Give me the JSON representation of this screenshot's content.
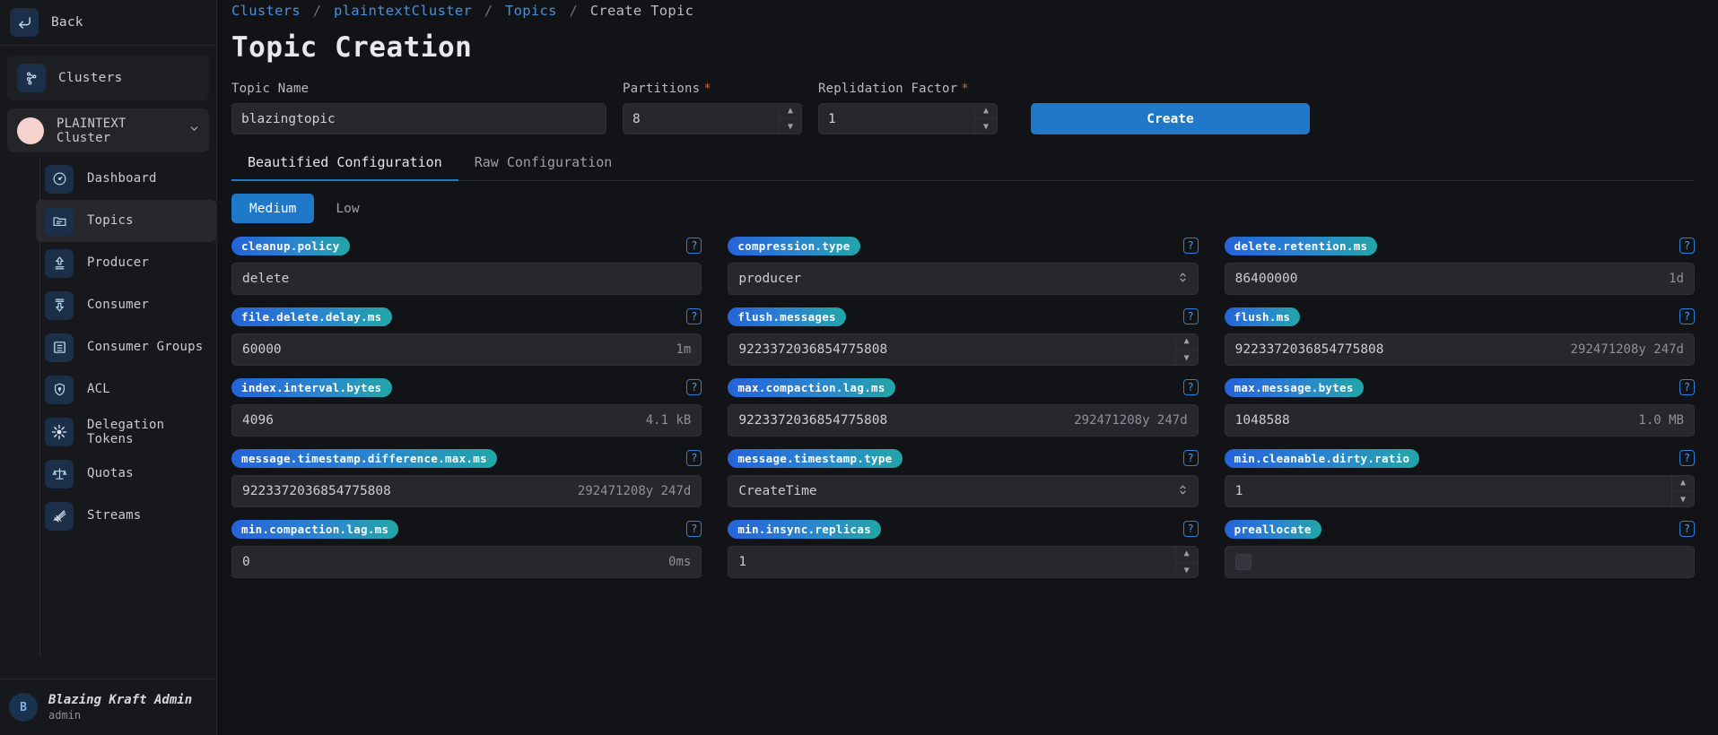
{
  "sidebar": {
    "back_label": "Back",
    "back_icon": "back-arrow-icon",
    "clusters_label": "Clusters",
    "clusters_icon": "cluster-nodes-icon",
    "selected_cluster": "PLAINTEXT Cluster",
    "chevron": "⌄",
    "nav": [
      {
        "label": "Dashboard",
        "icon": "gauge-icon",
        "active": false
      },
      {
        "label": "Topics",
        "icon": "folder-icon",
        "active": true
      },
      {
        "label": "Producer",
        "icon": "upload-arrow-icon",
        "active": false
      },
      {
        "label": "Consumer",
        "icon": "download-arrow-icon",
        "active": false
      },
      {
        "label": "Consumer Groups",
        "icon": "group-list-icon",
        "active": false
      },
      {
        "label": "ACL",
        "icon": "shield-lock-icon",
        "active": false
      },
      {
        "label": "Delegation Tokens",
        "icon": "token-burst-icon",
        "active": false
      },
      {
        "label": "Quotas",
        "icon": "scales-icon",
        "active": false
      },
      {
        "label": "Streams",
        "icon": "streams-icon",
        "active": false
      }
    ],
    "user": {
      "initial": "B",
      "name": "Blazing Kraft Admin",
      "role": "admin"
    }
  },
  "breadcrumb": {
    "items": [
      "Clusters",
      "plaintextCluster",
      "Topics"
    ],
    "current": "Create Topic",
    "separator": "/"
  },
  "page": {
    "title": "Topic Creation"
  },
  "form": {
    "topic_name": {
      "label": "Topic Name",
      "value": "blazingtopic",
      "required": false
    },
    "partitions": {
      "label": "Partitions",
      "value": "8",
      "required": true
    },
    "replication": {
      "label": "Replidation Factor",
      "value": "1",
      "required": true
    },
    "required_marker": "*",
    "create_button": "Create"
  },
  "tabs": [
    {
      "label": "Beautified Configuration",
      "active": true
    },
    {
      "label": "Raw Configuration",
      "active": false
    }
  ],
  "levels": [
    {
      "label": "Medium",
      "active": true
    },
    {
      "label": "Low",
      "active": false
    }
  ],
  "help_glyph": "?",
  "configs": [
    {
      "name": "cleanup.policy",
      "value": "delete",
      "suffix": "",
      "control": "text"
    },
    {
      "name": "compression.type",
      "value": "producer",
      "suffix": "",
      "control": "select"
    },
    {
      "name": "delete.retention.ms",
      "value": "86400000",
      "suffix": "1d",
      "control": "text"
    },
    {
      "name": "file.delete.delay.ms",
      "value": "60000",
      "suffix": "1m",
      "control": "text"
    },
    {
      "name": "flush.messages",
      "value": "9223372036854775808",
      "suffix": "",
      "control": "number"
    },
    {
      "name": "flush.ms",
      "value": "9223372036854775808",
      "suffix": "292471208y 247d",
      "control": "text"
    },
    {
      "name": "index.interval.bytes",
      "value": "4096",
      "suffix": "4.1 kB",
      "control": "text"
    },
    {
      "name": "max.compaction.lag.ms",
      "value": "9223372036854775808",
      "suffix": "292471208y 247d",
      "control": "text"
    },
    {
      "name": "max.message.bytes",
      "value": "1048588",
      "suffix": "1.0 MB",
      "control": "text"
    },
    {
      "name": "message.timestamp.difference.max.ms",
      "value": "9223372036854775808",
      "suffix": "292471208y 247d",
      "control": "text"
    },
    {
      "name": "message.timestamp.type",
      "value": "CreateTime",
      "suffix": "",
      "control": "select"
    },
    {
      "name": "min.cleanable.dirty.ratio",
      "value": "1",
      "suffix": "",
      "control": "number"
    },
    {
      "name": "min.compaction.lag.ms",
      "value": "0",
      "suffix": "0ms",
      "control": "text"
    },
    {
      "name": "min.insync.replicas",
      "value": "1",
      "suffix": "",
      "control": "number"
    },
    {
      "name": "preallocate",
      "value": "",
      "suffix": "",
      "control": "checkbox"
    }
  ],
  "colors": {
    "accent": "#1f78c8",
    "pill_from": "#2563d9",
    "pill_to": "#22a6a8",
    "link": "#4a90d9",
    "required": "#c0694a",
    "panel": "#26282d",
    "bg": "#121316"
  }
}
